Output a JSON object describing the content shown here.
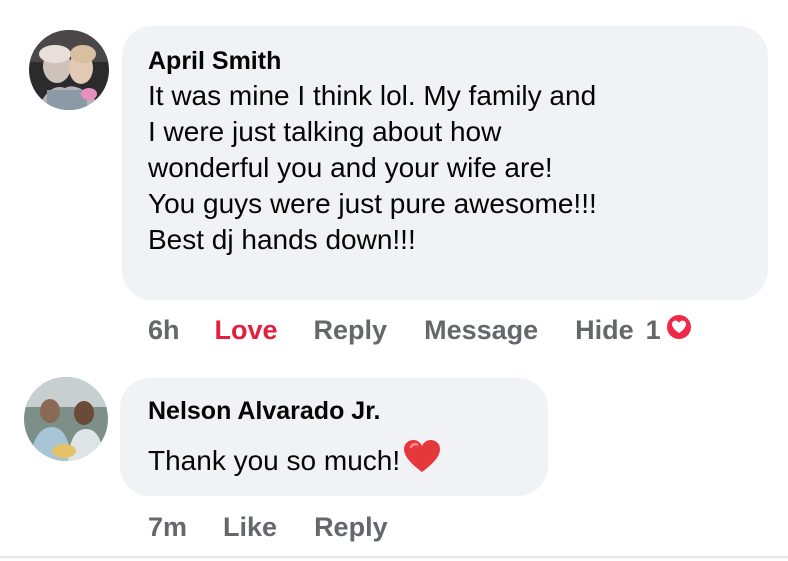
{
  "comments": [
    {
      "author": "April Smith",
      "lines": [
        "It was mine I think lol. My family and",
        "I were just talking about how",
        "wonderful you and your wife are!",
        "You guys were just pure awesome!!!",
        "Best dj hands down!!!"
      ],
      "actions": {
        "time": "6h",
        "react": "Love",
        "reply": "Reply",
        "message": "Message",
        "hide": "Hide",
        "reaction_count": "1",
        "reaction_icon": "heart-reaction-icon"
      }
    },
    {
      "author": "Nelson Alvarado Jr.",
      "text": "Thank you so much!",
      "emoji": "red-heart-emoji",
      "actions": {
        "time": "7m",
        "like": "Like",
        "reply": "Reply"
      }
    }
  ],
  "colors": {
    "bubble": "#f0f2f5",
    "love": "#e41e3f",
    "meta": "#65676b",
    "text": "#050505"
  }
}
